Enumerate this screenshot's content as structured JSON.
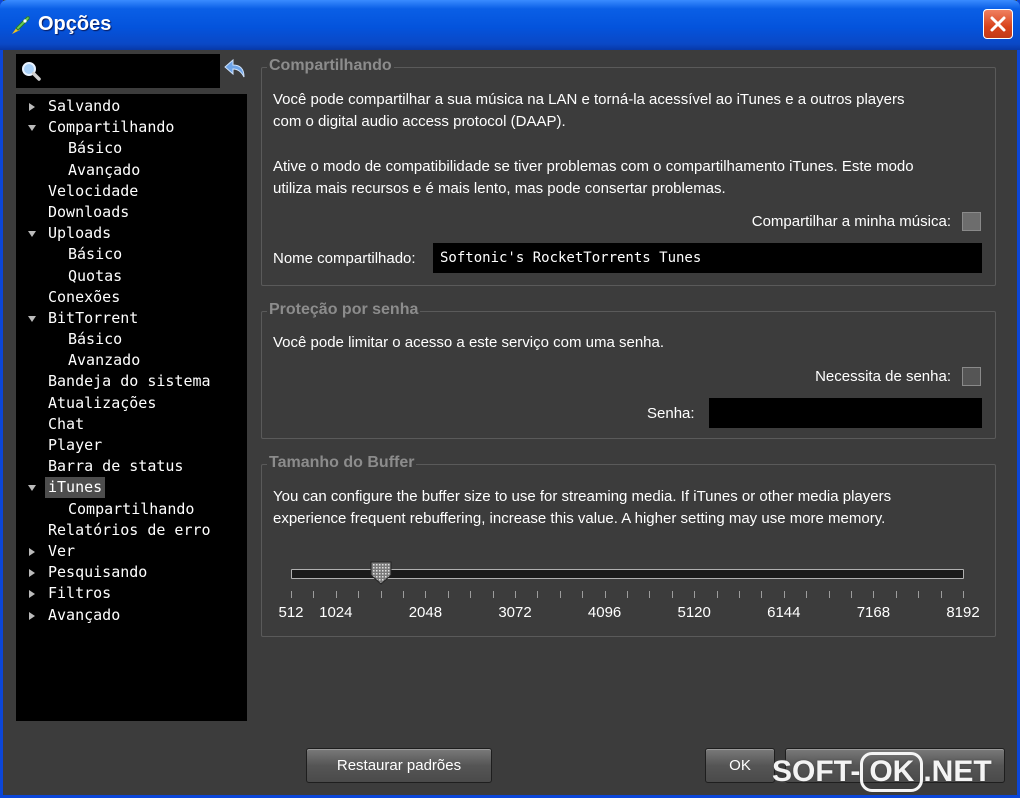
{
  "window": {
    "title": "Opções"
  },
  "search": {
    "placeholder": ""
  },
  "tree": [
    {
      "label": "Salvando",
      "arrow": "right",
      "child": false
    },
    {
      "label": "Compartilhando",
      "arrow": "down",
      "child": false
    },
    {
      "label": "Básico",
      "arrow": "",
      "child": true
    },
    {
      "label": "Avançado",
      "arrow": "",
      "child": true
    },
    {
      "label": "Velocidade",
      "arrow": "",
      "child": false
    },
    {
      "label": "Downloads",
      "arrow": "",
      "child": false
    },
    {
      "label": "Uploads",
      "arrow": "down",
      "child": false
    },
    {
      "label": "Básico",
      "arrow": "",
      "child": true
    },
    {
      "label": "Quotas",
      "arrow": "",
      "child": true
    },
    {
      "label": "Conexões",
      "arrow": "",
      "child": false
    },
    {
      "label": "BitTorrent",
      "arrow": "down",
      "child": false
    },
    {
      "label": "Básico",
      "arrow": "",
      "child": true
    },
    {
      "label": "Avanzado",
      "arrow": "",
      "child": true
    },
    {
      "label": "Bandeja do sistema",
      "arrow": "",
      "child": false
    },
    {
      "label": "Atualizações",
      "arrow": "",
      "child": false
    },
    {
      "label": "Chat",
      "arrow": "",
      "child": false
    },
    {
      "label": "Player",
      "arrow": "",
      "child": false
    },
    {
      "label": "Barra de status",
      "arrow": "",
      "child": false
    },
    {
      "label": "iTunes",
      "arrow": "down",
      "child": false,
      "selected": true
    },
    {
      "label": "Compartilhando",
      "arrow": "",
      "child": true
    },
    {
      "label": "Relatórios de erro",
      "arrow": "",
      "child": false
    },
    {
      "label": "Ver",
      "arrow": "right",
      "child": false
    },
    {
      "label": "Pesquisando",
      "arrow": "right",
      "child": false
    },
    {
      "label": "Filtros",
      "arrow": "right",
      "child": false
    },
    {
      "label": "Avançado",
      "arrow": "right",
      "child": false
    }
  ],
  "sharing": {
    "title": "Compartilhando",
    "desc1a": "Você pode compartilhar a sua música na LAN e torná-la acessível ao iTunes e a outros players",
    "desc1b": "com o digital audio access protocol (DAAP).",
    "desc2a": "Ative o modo de compatibilidade se tiver problemas com o compartilhamento iTunes. Este modo",
    "desc2b": "utiliza mais recursos e é mais lento, mas pode consertar problemas.",
    "share_label": "Compartilhar a minha música:",
    "share_checked": true,
    "name_label": "Nome compartilhado:",
    "name_value": "Softonic's RocketTorrents Tunes"
  },
  "password": {
    "title": "Proteção por senha",
    "desc": "Você pode limitar o acesso a este serviço com uma senha.",
    "require_label": "Necessita de senha:",
    "require_checked": false,
    "password_label": "Senha:",
    "password_value": ""
  },
  "buffer": {
    "title": "Tamanho do Buffer",
    "desc_a": "You can configure the buffer size to use for streaming media. If iTunes or other media players",
    "desc_b": "experience frequent rebuffering, increase this value. A higher setting may use more memory.",
    "min": 512,
    "max": 8192,
    "value": 1536,
    "tick_labels": [
      "512",
      "1024",
      "2048",
      "3072",
      "4096",
      "5120",
      "6144",
      "7168",
      "8192"
    ]
  },
  "buttons": {
    "restore": "Restaurar padrões",
    "ok": "OK"
  },
  "watermark": {
    "left": "SOFT-",
    "ok": "OK",
    "right": ".NET"
  },
  "colors": {
    "titlebar": "#0453dc",
    "window_bg": "#3c3c3c",
    "close": "#d8431c"
  }
}
